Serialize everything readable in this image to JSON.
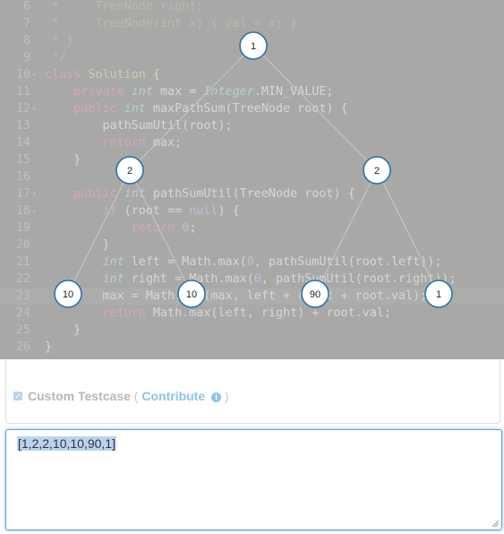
{
  "editor": {
    "lines": [
      {
        "n": "6",
        "fold": "",
        "tokens": [
          {
            "t": "com",
            "v": " *     TreeNode right;"
          }
        ]
      },
      {
        "n": "7",
        "fold": "",
        "tokens": [
          {
            "t": "com",
            "v": " *     TreeNode(int x) { val = x; }"
          }
        ]
      },
      {
        "n": "8",
        "fold": "",
        "tokens": [
          {
            "t": "com",
            "v": " * }"
          }
        ]
      },
      {
        "n": "9",
        "fold": "",
        "tokens": [
          {
            "t": "com",
            "v": " */"
          }
        ]
      },
      {
        "n": "10",
        "fold": "▾",
        "tokens": [
          {
            "t": "kw",
            "v": "class"
          },
          {
            "t": "plain",
            "v": " "
          },
          {
            "t": "cls",
            "v": "Solution"
          },
          {
            "t": "plain",
            "v": " {"
          }
        ]
      },
      {
        "n": "11",
        "fold": "",
        "tokens": [
          {
            "t": "plain",
            "v": "    "
          },
          {
            "t": "kw",
            "v": "private"
          },
          {
            "t": "plain",
            "v": " "
          },
          {
            "t": "type",
            "v": "int"
          },
          {
            "t": "plain",
            "v": " max = "
          },
          {
            "t": "type",
            "v": "Integer"
          },
          {
            "t": "plain",
            "v": ".MIN_VALUE;"
          }
        ]
      },
      {
        "n": "12",
        "fold": "▾",
        "tokens": [
          {
            "t": "plain",
            "v": "    "
          },
          {
            "t": "kw",
            "v": "public"
          },
          {
            "t": "plain",
            "v": " "
          },
          {
            "t": "type",
            "v": "int"
          },
          {
            "t": "plain",
            "v": " maxPathSum(TreeNode root) {"
          }
        ]
      },
      {
        "n": "13",
        "fold": "",
        "tokens": [
          {
            "t": "plain",
            "v": "        pathSumUtil(root);"
          }
        ]
      },
      {
        "n": "14",
        "fold": "",
        "tokens": [
          {
            "t": "plain",
            "v": "        "
          },
          {
            "t": "kw",
            "v": "return"
          },
          {
            "t": "plain",
            "v": " max;"
          }
        ]
      },
      {
        "n": "15",
        "fold": "",
        "tokens": [
          {
            "t": "plain",
            "v": "    }"
          }
        ]
      },
      {
        "n": "16",
        "fold": "",
        "tokens": [
          {
            "t": "plain",
            "v": ""
          }
        ]
      },
      {
        "n": "17",
        "fold": "▾",
        "tokens": [
          {
            "t": "plain",
            "v": "    "
          },
          {
            "t": "kw",
            "v": "public"
          },
          {
            "t": "plain",
            "v": " "
          },
          {
            "t": "type",
            "v": "int"
          },
          {
            "t": "plain",
            "v": " pathSumUtil(TreeNode root) {"
          }
        ]
      },
      {
        "n": "18",
        "fold": "▾",
        "tokens": [
          {
            "t": "plain",
            "v": "        "
          },
          {
            "t": "kw",
            "v": "if"
          },
          {
            "t": "plain",
            "v": " (root == "
          },
          {
            "t": "const",
            "v": "null"
          },
          {
            "t": "plain",
            "v": ") {"
          }
        ]
      },
      {
        "n": "19",
        "fold": "",
        "tokens": [
          {
            "t": "plain",
            "v": "            "
          },
          {
            "t": "kw",
            "v": "return"
          },
          {
            "t": "plain",
            "v": " "
          },
          {
            "t": "num",
            "v": "0"
          },
          {
            "t": "plain",
            "v": ";"
          }
        ]
      },
      {
        "n": "20",
        "fold": "",
        "tokens": [
          {
            "t": "plain",
            "v": "        }"
          }
        ]
      },
      {
        "n": "21",
        "fold": "",
        "tokens": [
          {
            "t": "plain",
            "v": "        "
          },
          {
            "t": "type",
            "v": "int"
          },
          {
            "t": "plain",
            "v": " left = Math.max("
          },
          {
            "t": "num",
            "v": "0"
          },
          {
            "t": "plain",
            "v": ", pathSumUtil(root.left));"
          }
        ]
      },
      {
        "n": "22",
        "fold": "",
        "tokens": [
          {
            "t": "plain",
            "v": "        "
          },
          {
            "t": "type",
            "v": "int"
          },
          {
            "t": "plain",
            "v": " right = Math.max("
          },
          {
            "t": "num",
            "v": "0"
          },
          {
            "t": "plain",
            "v": ", pathSumUtil(root.right));"
          }
        ]
      },
      {
        "n": "23",
        "fold": "",
        "active": true,
        "tokens": [
          {
            "t": "plain",
            "v": "        max = Math.max(max, left + right + root.val);"
          }
        ]
      },
      {
        "n": "24",
        "fold": "",
        "tokens": [
          {
            "t": "plain",
            "v": "        "
          },
          {
            "t": "kw",
            "v": "return"
          },
          {
            "t": "plain",
            "v": " Math.max(left, right) + root.val;"
          }
        ]
      },
      {
        "n": "25",
        "fold": "",
        "tokens": [
          {
            "t": "plain",
            "v": "    }"
          }
        ]
      },
      {
        "n": "26",
        "fold": "",
        "tokens": [
          {
            "t": "plain",
            "v": "}"
          }
        ]
      }
    ]
  },
  "tree": {
    "nodes": [
      {
        "id": "root",
        "label": "1"
      },
      {
        "id": "l",
        "label": "2"
      },
      {
        "id": "r",
        "label": "2"
      },
      {
        "id": "ll",
        "label": "10"
      },
      {
        "id": "lr",
        "label": "10"
      },
      {
        "id": "rl",
        "label": "90"
      },
      {
        "id": "rr",
        "label": "1"
      }
    ],
    "edges": [
      [
        "root",
        "l"
      ],
      [
        "root",
        "r"
      ],
      [
        "l",
        "ll"
      ],
      [
        "l",
        "lr"
      ],
      [
        "r",
        "rl"
      ],
      [
        "r",
        "rr"
      ]
    ]
  },
  "testcase": {
    "checkbox_label": "Custom Testcase",
    "open_paren": "(",
    "contribute_label": "Contribute",
    "info_icon": "info-icon",
    "close_paren": ")",
    "input_value": "[1,2,2,10,10,90,1]"
  },
  "colors": {
    "node_border": "#2f6fa8",
    "focus": "#5b9ddb"
  }
}
